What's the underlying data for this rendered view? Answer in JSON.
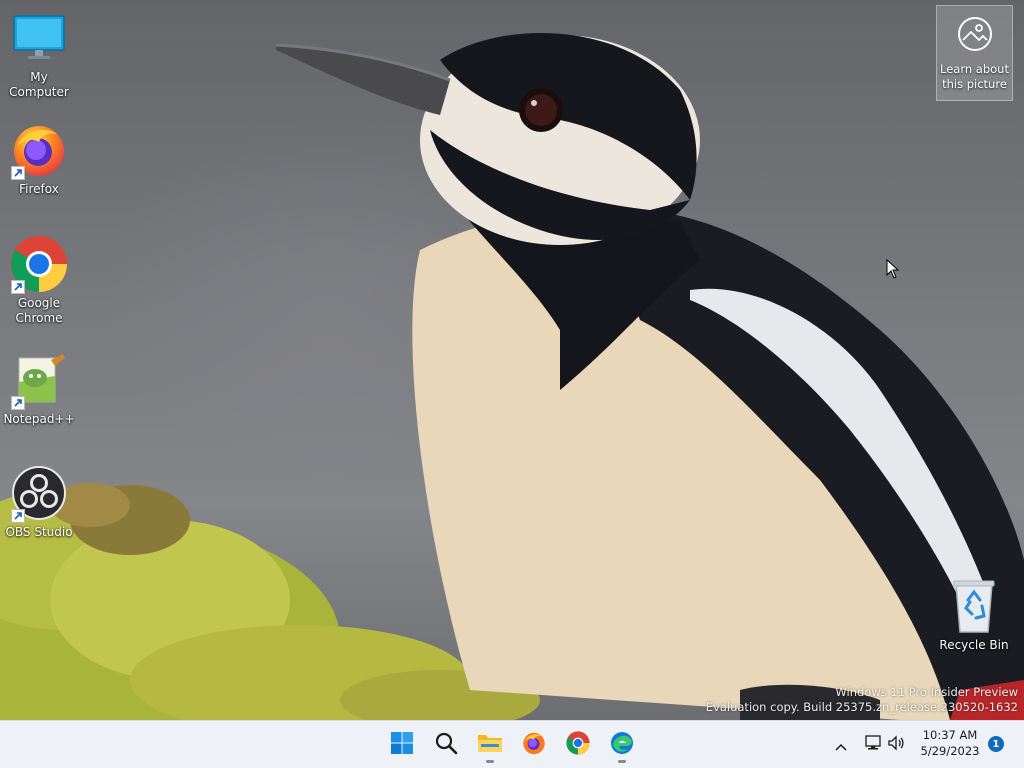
{
  "desktop": {
    "icons": [
      {
        "label": "My Computer",
        "icon": "monitor-icon"
      },
      {
        "label": "Firefox",
        "icon": "firefox-icon"
      },
      {
        "label": "Google Chrome",
        "icon": "chrome-icon"
      },
      {
        "label": "Notepad++",
        "icon": "notepadpp-icon"
      },
      {
        "label": "OBS Studio",
        "icon": "obs-icon"
      },
      {
        "label": "Recycle Bin",
        "icon": "recycle-bin-icon"
      }
    ],
    "spotlight": {
      "label": "Learn about this picture",
      "icon": "image-info-icon"
    },
    "watermark": {
      "line1": "Windows 11 Pro Insider Preview",
      "line2": "Evaluation copy. Build 25375.zn_release.230520-1632"
    }
  },
  "taskbar": {
    "apps": [
      {
        "name": "Start",
        "icon": "windows-start-icon"
      },
      {
        "name": "Search",
        "icon": "search-icon"
      },
      {
        "name": "File Explorer",
        "icon": "folder-icon"
      },
      {
        "name": "Firefox",
        "icon": "firefox-icon"
      },
      {
        "name": "Google Chrome",
        "icon": "chrome-icon"
      },
      {
        "name": "Microsoft Edge",
        "icon": "edge-icon"
      }
    ],
    "clock": {
      "time": "10:37 AM",
      "date": "5/29/2023"
    },
    "notification_count": "1"
  },
  "colors": {
    "accent": "#0f6cbd",
    "taskbar_bg": "#eef1f6"
  }
}
